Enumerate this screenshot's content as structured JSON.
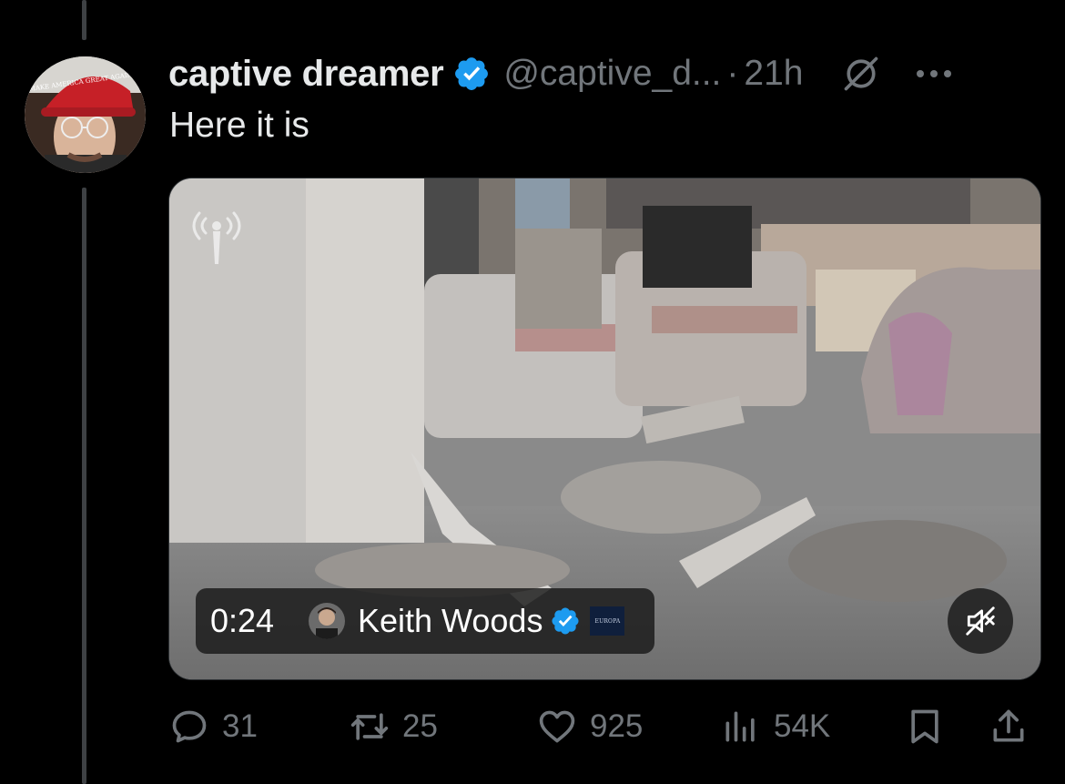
{
  "tweet": {
    "display_name": "captive dreamer",
    "handle": "@captive_d...",
    "separator": "·",
    "time": "21h",
    "text": "Here it is",
    "avatar_hat_text": "MAKE AMERICA GREAT AGAIN"
  },
  "media": {
    "duration": "0:24",
    "source_name": "Keith Woods",
    "source_badge": "EUROPA",
    "muted": true
  },
  "actions": {
    "replies": "31",
    "reposts": "25",
    "likes": "925",
    "views": "54K"
  },
  "icons": {
    "verified": "verified-badge-icon",
    "grok": "grok-icon",
    "more": "more-icon",
    "reply": "reply-icon",
    "repost": "repost-icon",
    "like": "heart-icon",
    "views": "views-icon",
    "bookmark": "bookmark-icon",
    "share": "share-icon",
    "mute": "muted-speaker-icon"
  },
  "colors": {
    "background": "#000000",
    "text_primary": "#e7e9ea",
    "text_secondary": "#71767b",
    "verified_blue": "#1d9bf0"
  }
}
